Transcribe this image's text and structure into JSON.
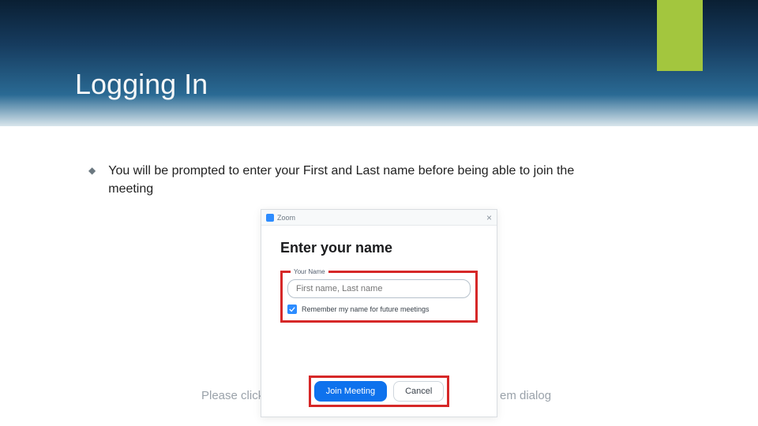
{
  "slide": {
    "title": "Logging In",
    "bullet": "You will be prompted to enter your First and Last name before being able to join the meeting"
  },
  "dialog": {
    "app_name": "Zoom",
    "close_glyph": "×",
    "heading": "Enter your name",
    "field_label": "Your Name",
    "name_placeholder": "First name, Last name",
    "remember_label": "Remember my name for future meetings",
    "remember_checked": true,
    "join_label": "Join Meeting",
    "cancel_label": "Cancel"
  },
  "background_hints": {
    "left": "Please click",
    "right": "em dialog"
  }
}
